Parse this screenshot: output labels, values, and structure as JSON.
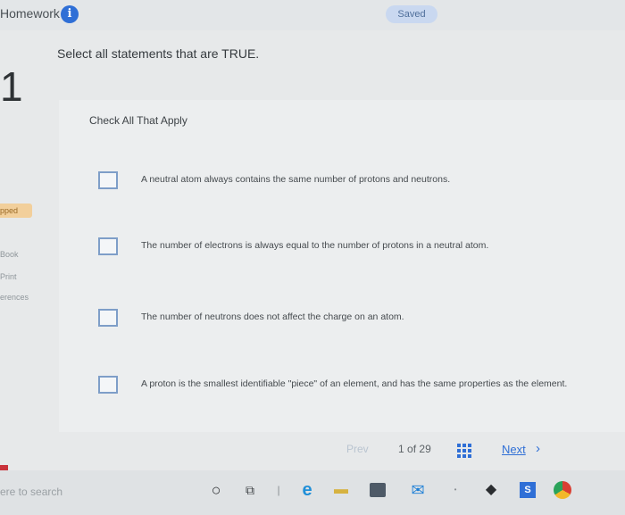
{
  "topbar": {
    "title": "Homework",
    "info_icon": "info-icon",
    "saved_label": "Saved"
  },
  "left_rail": {
    "question_number": "1",
    "skipped_label": "pped",
    "ebook_label": "Book",
    "print_label": "Print",
    "references_label": "erences"
  },
  "question": {
    "prompt": "Select all statements that are TRUE.",
    "instruction": "Check All That Apply",
    "options": [
      {
        "text": "A neutral atom always contains the same number of protons and neutrons.",
        "checked": false
      },
      {
        "text": "The number of electrons is always equal to the number of protons in a neutral atom.",
        "checked": false
      },
      {
        "text": "The number of neutrons does not affect the charge on an atom.",
        "checked": false
      },
      {
        "text": "A proton is the smallest identifiable \"piece\" of an element, and has the same properties as the element.",
        "checked": false
      }
    ]
  },
  "pager": {
    "prev_label": "Prev",
    "current": "1",
    "of_label": "of",
    "total": "29",
    "next_label": "Next",
    "next_icon": "chevron-right-icon",
    "grid_icon": "grid-icon"
  },
  "taskbar": {
    "search_placeholder": "ere to search",
    "icons": [
      "cortana-icon",
      "task-view-icon",
      "edge-icon",
      "file-explorer-icon",
      "store-icon",
      "mail-icon",
      "dropbox-icon",
      "office-icon",
      "chrome-icon"
    ]
  },
  "colors": {
    "accent": "#2f6fd6",
    "saved_badge": "#c9d8f0",
    "checkbox_border": "#7e9ec8",
    "skipped_tab": "#f2cf9b",
    "red_tab": "#c9333b"
  }
}
